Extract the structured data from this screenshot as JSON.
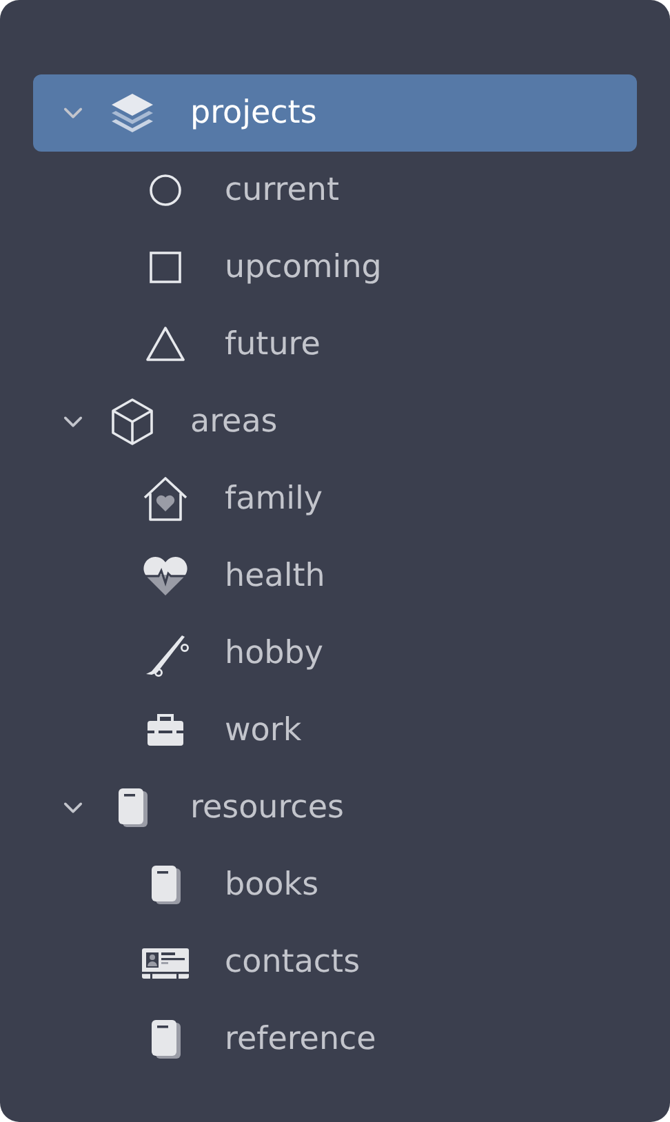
{
  "tree": [
    {
      "label": "projects",
      "expanded": true,
      "selected": true,
      "children": [
        {
          "label": "current",
          "selected": false
        },
        {
          "label": "upcoming",
          "selected": false
        },
        {
          "label": "future",
          "selected": false
        }
      ]
    },
    {
      "label": "areas",
      "expanded": true,
      "selected": false,
      "children": [
        {
          "label": "family",
          "selected": false
        },
        {
          "label": "health",
          "selected": false
        },
        {
          "label": "hobby",
          "selected": false
        },
        {
          "label": "work",
          "selected": false
        }
      ]
    },
    {
      "label": "resources",
      "expanded": true,
      "selected": false,
      "children": [
        {
          "label": "books",
          "selected": false
        },
        {
          "label": "contacts",
          "selected": false
        },
        {
          "label": "reference",
          "selected": false
        }
      ]
    }
  ]
}
